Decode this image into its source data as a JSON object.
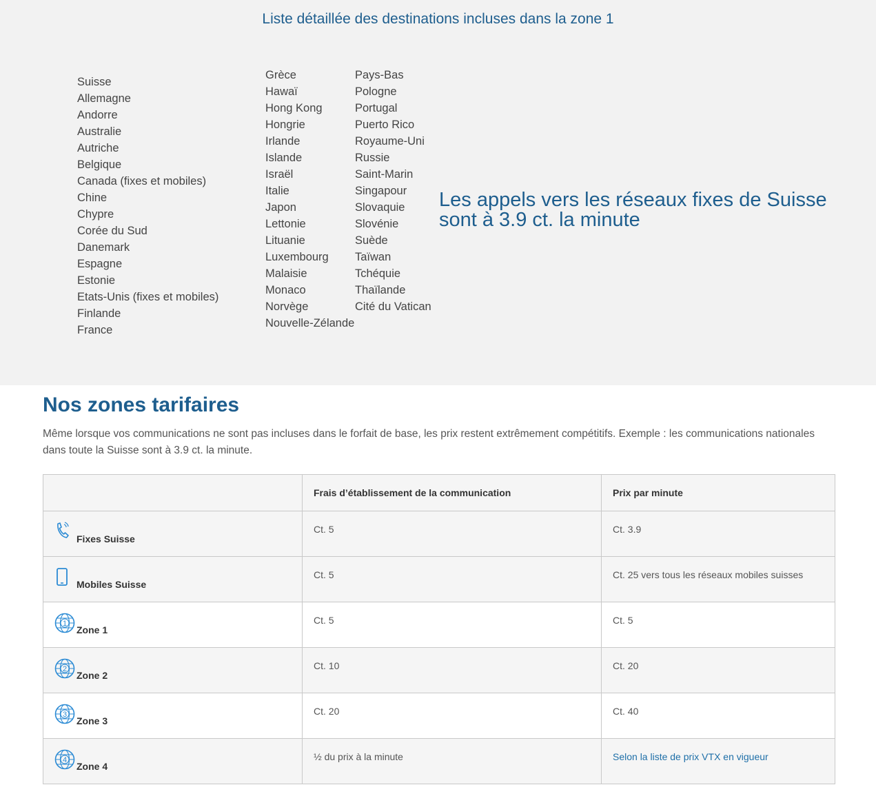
{
  "zone1_section": {
    "title": "Liste détaillée des destinations incluses dans la zone 1",
    "column1": [
      "Suisse",
      "Allemagne",
      "Andorre",
      "Australie",
      "Autriche",
      "Belgique",
      "Canada (fixes et mobiles)",
      "Chine",
      "Chypre",
      "Corée du Sud",
      "Danemark",
      "Espagne",
      "Estonie",
      "Etats-Unis (fixes et mobiles)",
      "Finlande",
      "France"
    ],
    "column2": [
      "Grèce",
      "Hawaï",
      "Hong Kong",
      "Hongrie",
      "Irlande",
      "Islande",
      "Israël",
      "Italie",
      "Japon",
      "Lettonie",
      "Lituanie",
      "Luxembourg",
      "Malaisie",
      "Monaco",
      "Norvège",
      "Nouvelle-Zélande"
    ],
    "column3": [
      "Pays-Bas",
      "Pologne",
      "Portugal",
      "Puerto Rico",
      "Royaume-Uni",
      "Russie",
      "Saint-Marin",
      "Singapour",
      "Slovaquie",
      "Slovénie",
      "Suède",
      "Taïwan",
      "Tchéquie",
      "Thaïlande",
      "Cité du Vatican"
    ],
    "highlight_line1": "Les appels vers les réseaux fixes de Suisse",
    "highlight_line2": "sont à 3.9 ct. la minute"
  },
  "zones": {
    "title": "Nos zones tarifaires",
    "intro": "Même lorsque vos communications ne sont pas incluses dans le forfait de base, les prix restent extrêmement compétitifs. Exemple : les communications nationales dans toute la Suisse sont à 3.9 ct. la minute.",
    "headers": {
      "empty": "",
      "setup_fee": "Frais d’établissement de la communication",
      "per_minute": "Prix par minute"
    },
    "rows": [
      {
        "icon": "landline-phone-icon",
        "label": "Fixes Suisse",
        "setup": "Ct. 5",
        "per_minute": "Ct. 3.9"
      },
      {
        "icon": "mobile-phone-icon",
        "label": "Mobiles Suisse",
        "setup": "Ct. 5",
        "per_minute": "Ct. 25 vers tous les réseaux mobiles suisses"
      },
      {
        "icon": "globe-zone-1-icon",
        "label": "Zone 1",
        "setup": "Ct. 5",
        "per_minute": "Ct. 5"
      },
      {
        "icon": "globe-zone-2-icon",
        "label": "Zone 2",
        "setup": "Ct. 10",
        "per_minute": "Ct. 20"
      },
      {
        "icon": "globe-zone-3-icon",
        "label": "Zone 3",
        "setup": "Ct. 20",
        "per_minute": "Ct. 40"
      },
      {
        "icon": "globe-zone-4-icon",
        "label": "Zone 4",
        "setup": "½ du prix à la minute",
        "per_minute": "Selon la liste de prix VTX en vigueur"
      }
    ],
    "globe_numbers": [
      "1",
      "2",
      "3",
      "4"
    ],
    "accent_color": "#1e5e8e",
    "icon_color": "#2a8ad4"
  }
}
